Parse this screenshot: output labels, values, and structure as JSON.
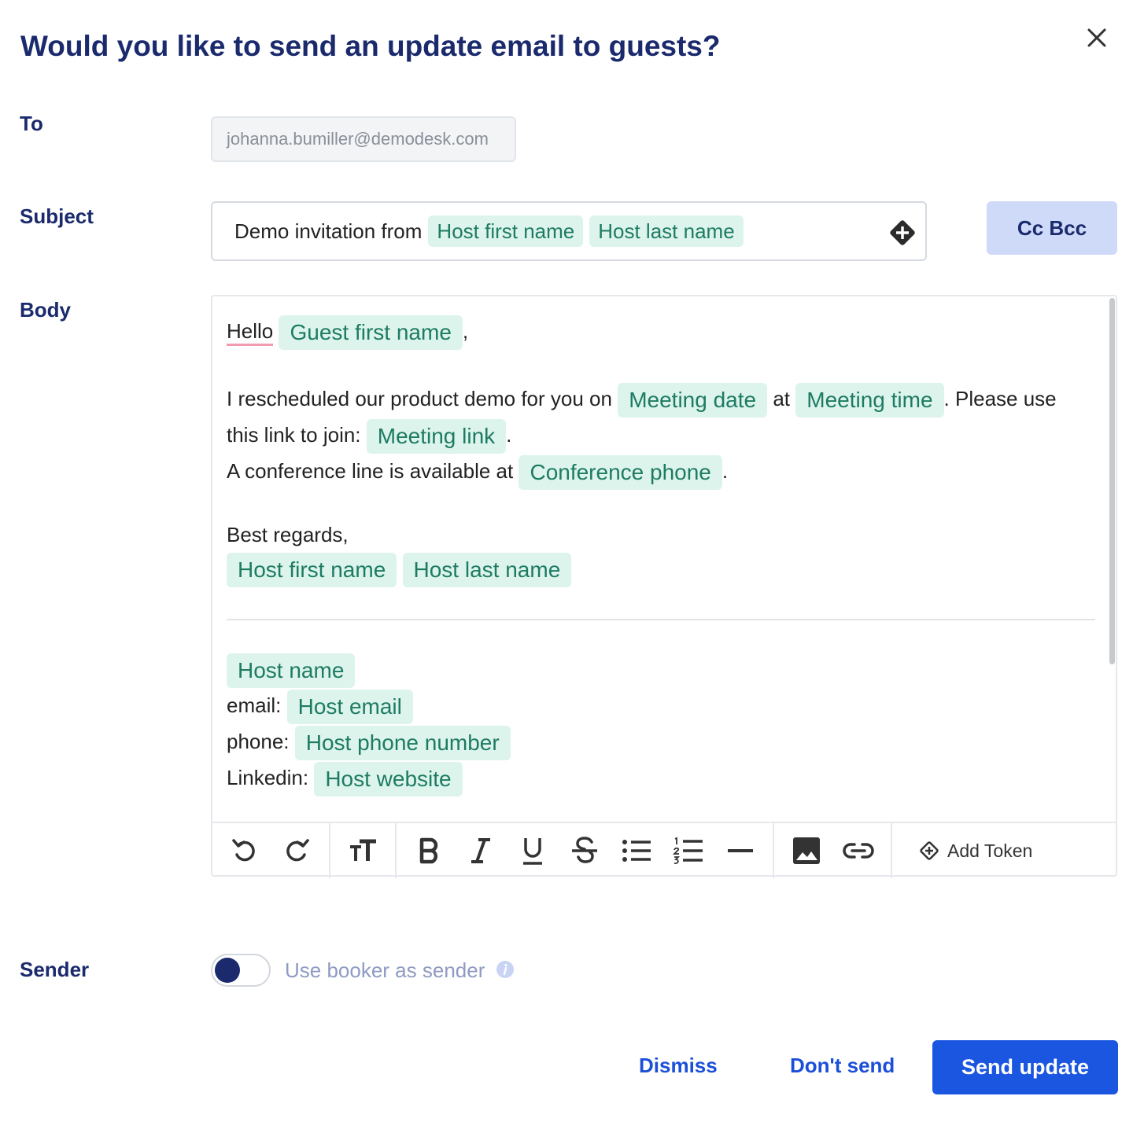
{
  "dialog": {
    "title": "Would you like to send an update email to guests?"
  },
  "to": {
    "label": "To",
    "value": "johanna.bumiller@demodesk.com"
  },
  "subject": {
    "label": "Subject",
    "text": "Demo invitation from",
    "tokens": [
      "Host first name",
      "Host last name"
    ],
    "cc_bcc_label": "Cc Bcc"
  },
  "body": {
    "label": "Body",
    "greeting": "Hello",
    "greeting_token": "Guest first name",
    "greeting_end": ",",
    "line2_a": "I rescheduled our product demo for you on",
    "line2_token1": "Meeting date",
    "line2_b": "at",
    "line2_token2": "Meeting time",
    "line2_c": ". Please use",
    "line3_a": "this link to join:",
    "line3_token": "Meeting link",
    "line3_end": ".",
    "line4_a": "A conference line is available at",
    "line4_token": "Conference phone",
    "line4_end": ".",
    "regards": "Best regards,",
    "sig_token1": "Host first name",
    "sig_token2": "Host last name",
    "host_name_token": "Host name",
    "email_label": "email:",
    "email_token": "Host email",
    "phone_label": "phone:",
    "phone_token": "Host phone number",
    "linkedin_label": "Linkedin:",
    "website_token": "Host website"
  },
  "toolbar": {
    "icons": [
      "undo-icon",
      "redo-icon",
      "text-size-icon",
      "bold-icon",
      "italic-icon",
      "underline-icon",
      "strikethrough-icon",
      "bullet-list-icon",
      "numbered-list-icon",
      "horizontal-rule-icon",
      "image-icon",
      "link-icon"
    ],
    "add_token_label": "Add Token"
  },
  "sender": {
    "label": "Sender",
    "toggle_text": "Use booker as sender",
    "toggle_on": false
  },
  "footer": {
    "dismiss_label": "Dismiss",
    "dont_send_label": "Don't send",
    "send_label": "Send update"
  },
  "colors": {
    "heading": "#1a2a6c",
    "token_bg": "#dcf4ec",
    "token_text": "#1e7b62",
    "primary": "#1a56e0",
    "cc_bg": "#cfdaf8"
  }
}
